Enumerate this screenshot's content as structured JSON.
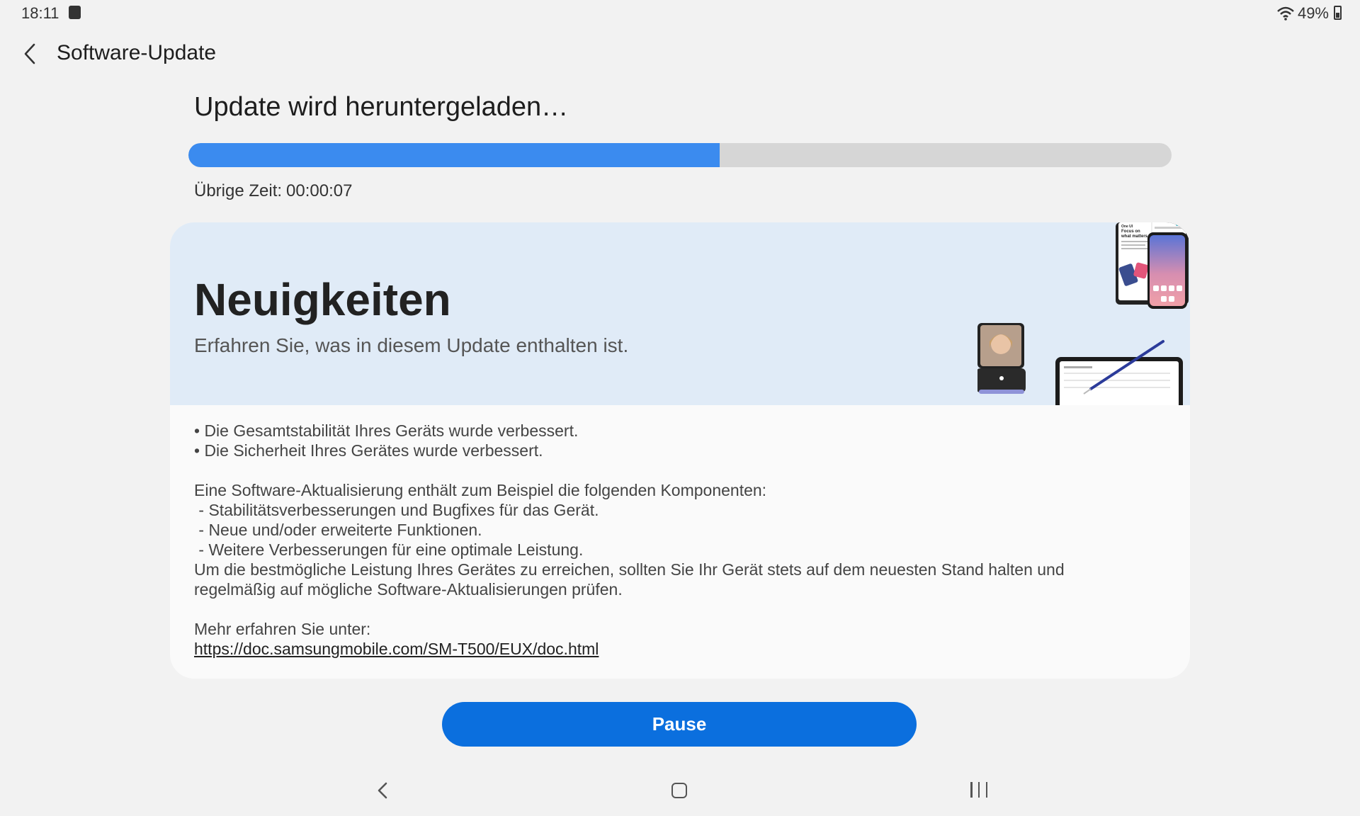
{
  "status_bar": {
    "time": "18:11",
    "battery_percent": "49%"
  },
  "app_bar": {
    "title": "Software-Update"
  },
  "download": {
    "title": "Update wird heruntergeladen…",
    "progress": 0.54,
    "remaining_label": "Übrige Zeit:",
    "remaining_value": "00:00:07"
  },
  "whats_new": {
    "title": "Neuigkeiten",
    "subtitle": "Erfahren Sie, was in diesem Update enthalten ist.",
    "illustration_text": [
      "One UI",
      "Focus on",
      "what matters"
    ],
    "lines": [
      "• Die Gesamtstabilität Ihres Geräts wurde verbessert.",
      "• Die Sicherheit Ihres Gerätes wurde verbessert.",
      "",
      "Eine Software-Aktualisierung enthält zum Beispiel die folgenden Komponenten:",
      " - Stabilitätsverbesserungen und Bugfixes für das Gerät.",
      " - Neue und/oder erweiterte Funktionen.",
      " - Weitere Verbesserungen für eine optimale Leistung.",
      "Um die bestmögliche Leistung Ihres Gerätes zu erreichen, sollten Sie Ihr Gerät stets auf dem neuesten Stand halten und",
      "regelmäßig auf mögliche Software-Aktualisierungen prüfen.",
      "",
      "Mehr erfahren Sie unter:"
    ],
    "link": "https://doc.samsungmobile.com/SM-T500/EUX/doc.html"
  },
  "pause_button": {
    "label": "Pause"
  },
  "colors": {
    "accent": "#0b6fde",
    "progress_fill": "#3b8bef",
    "banner_bg": "#e0ebf7"
  },
  "icons": [
    "notification-icon",
    "wifi-icon",
    "battery-icon",
    "back-arrow-icon",
    "nav-back-icon",
    "nav-home-icon",
    "nav-recents-icon"
  ]
}
